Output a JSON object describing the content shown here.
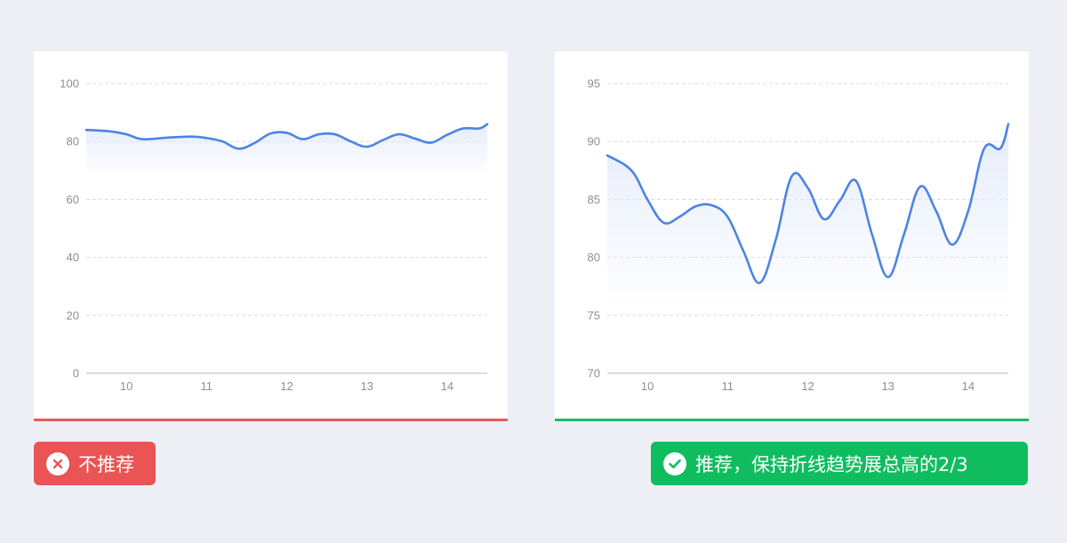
{
  "charts": {
    "left": {
      "chart_data": {
        "type": "line",
        "x_ticks": [
          "10",
          "11",
          "12",
          "13",
          "14"
        ],
        "y_ticks": [
          0,
          20,
          40,
          60,
          80,
          100
        ],
        "ylim": [
          0,
          100
        ],
        "xlim": [
          9.5,
          14.5
        ],
        "grid": true,
        "x": [
          9.5,
          9.8,
          10.0,
          10.2,
          10.5,
          10.8,
          11.0,
          11.2,
          11.4,
          11.6,
          11.8,
          12.0,
          12.2,
          12.4,
          12.6,
          12.8,
          13.0,
          13.2,
          13.4,
          13.6,
          13.8,
          14.0,
          14.2,
          14.4,
          14.5
        ],
        "y": [
          84,
          83.5,
          82.5,
          80.8,
          81.3,
          81.7,
          81.2,
          80,
          77.5,
          79.5,
          82.8,
          83,
          80.8,
          82.5,
          82.5,
          80,
          78.2,
          80.5,
          82.5,
          81,
          79.6,
          82.3,
          84.5,
          84.5,
          86
        ]
      }
    },
    "right": {
      "chart_data": {
        "type": "line",
        "x_ticks": [
          "10",
          "11",
          "12",
          "13",
          "14"
        ],
        "y_ticks": [
          70,
          75,
          80,
          85,
          90,
          95
        ],
        "ylim": [
          70,
          95
        ],
        "xlim": [
          9.5,
          14.5
        ],
        "grid": true,
        "x": [
          9.5,
          9.8,
          10.0,
          10.2,
          10.4,
          10.6,
          10.8,
          11.0,
          11.2,
          11.4,
          11.6,
          11.8,
          12.0,
          12.2,
          12.4,
          12.6,
          12.8,
          13.0,
          13.2,
          13.4,
          13.6,
          13.8,
          14.0,
          14.2,
          14.4,
          14.5
        ],
        "y": [
          88.8,
          87.5,
          85,
          83,
          83.5,
          84.4,
          84.5,
          83.5,
          80.5,
          77.8,
          81.5,
          87,
          86,
          83.3,
          84.9,
          86.6,
          82,
          78.3,
          82,
          86.1,
          84,
          81.1,
          84,
          89.4,
          89.4,
          91.5
        ]
      }
    }
  },
  "badges": {
    "bad": {
      "label": "不推荐",
      "color": "#ea5455",
      "icon": "close-icon"
    },
    "good": {
      "label": "推荐，保持折线趋势展总高的2/3",
      "color": "#0fbd5e",
      "icon": "check-icon"
    }
  },
  "colors": {
    "line": "#4d84e3",
    "area_top": "#e3ebfb",
    "grid": "#d8dbe2",
    "axis": "#c4c7ce",
    "tick_text": "#8a8f99"
  }
}
